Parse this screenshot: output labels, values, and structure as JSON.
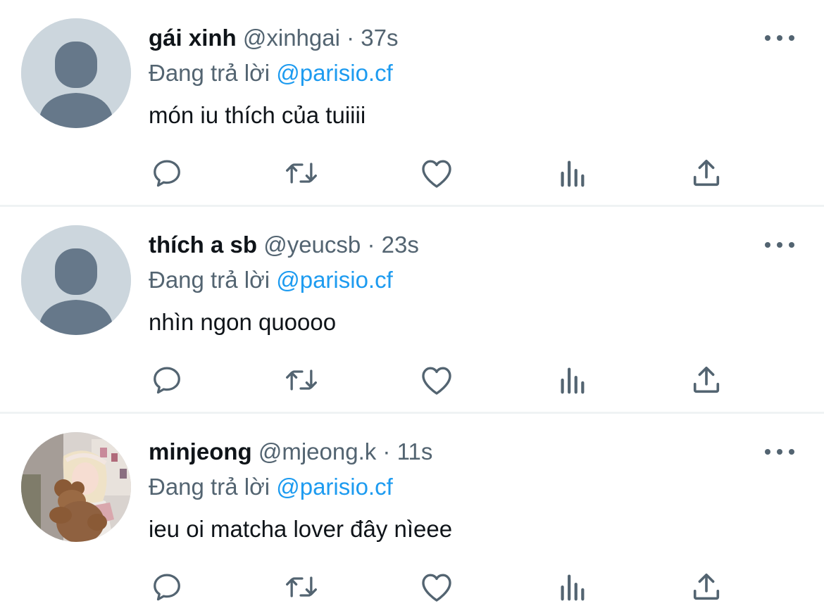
{
  "reply_prefix": "Đang trả lời",
  "tweets": [
    {
      "name": "gái xinh",
      "handle": "@xinhgai",
      "separator": "·",
      "time": "37s",
      "replying_to": "@parisio.cf",
      "text": "món iu thích của tuiiii",
      "avatar": "default-avatar-icon"
    },
    {
      "name": "thích a sb",
      "handle": "@yeucsb",
      "separator": "·",
      "time": "23s",
      "replying_to": "@parisio.cf",
      "text": "nhìn ngon quoooo",
      "avatar": "default-avatar-icon"
    },
    {
      "name": "minjeong",
      "handle": "@mjeong.k",
      "separator": "·",
      "time": "11s",
      "replying_to": "@parisio.cf",
      "text": "ieu oi matcha lover đây nìeee",
      "avatar": "profile-photo"
    }
  ],
  "actions": [
    "reply-icon",
    "retweet-icon",
    "like-icon",
    "views-icon",
    "share-icon"
  ],
  "colors": {
    "text": "#0f1419",
    "secondary": "#536471",
    "link": "#1d9bf0",
    "divider": "#eff3f4",
    "default_avatar_bg": "#ccd6dd",
    "default_avatar_fg": "#66788a"
  }
}
